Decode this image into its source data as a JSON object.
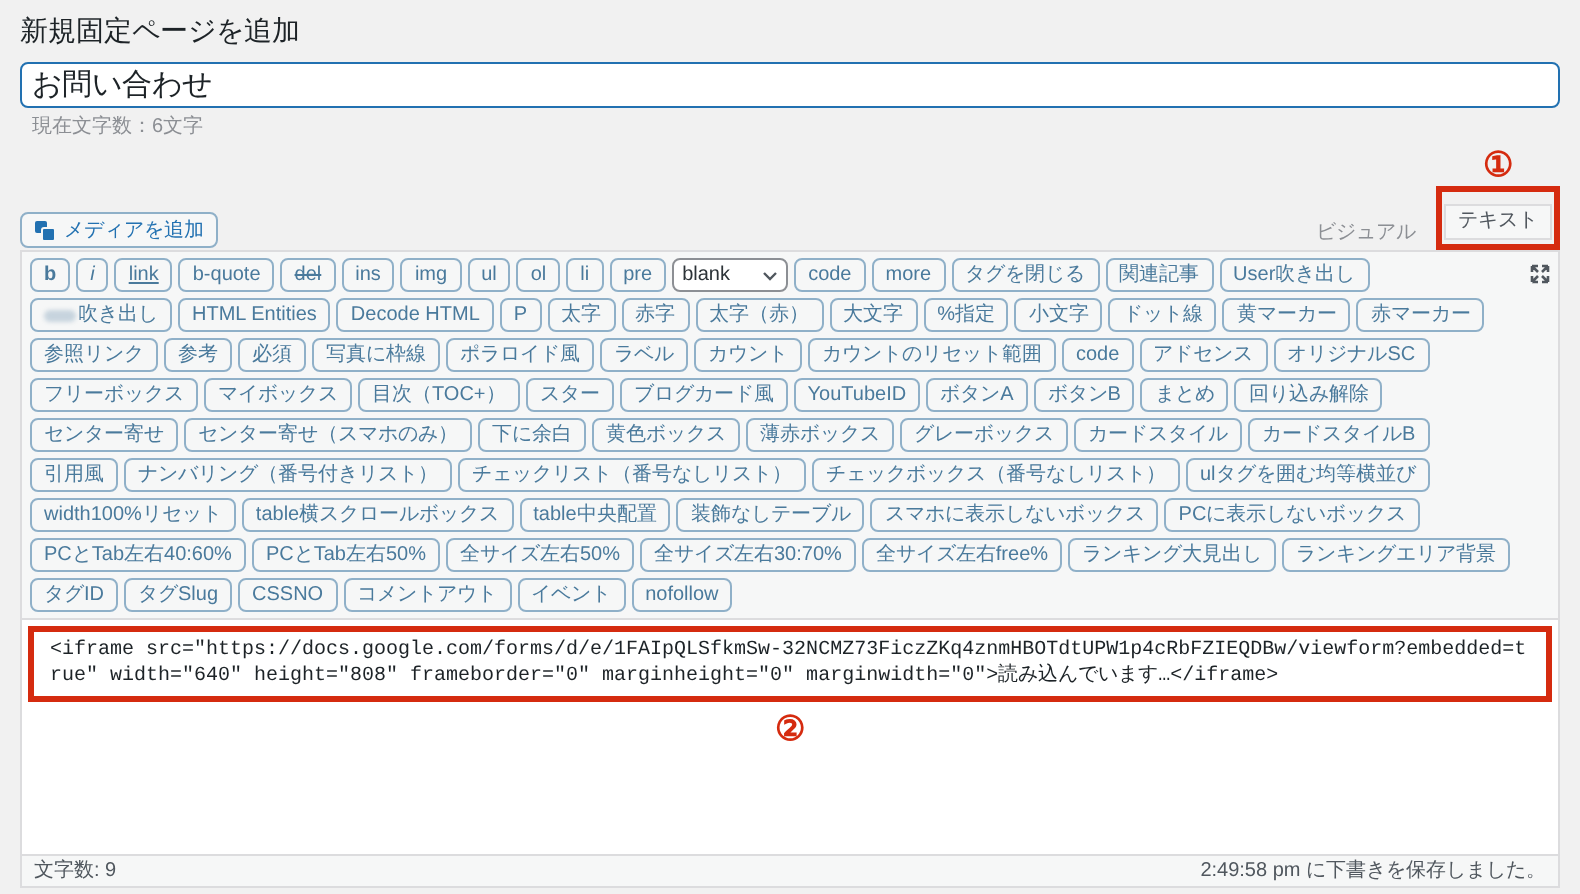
{
  "page_title": "新規固定ページを追加",
  "title_field": {
    "value": "お問い合わせ"
  },
  "char_count": "現在文字数：6文字",
  "media_button": "メディアを追加",
  "annotations": [
    "①",
    "②"
  ],
  "tabs": [
    {
      "label": "ビジュアル",
      "selected": false
    },
    {
      "label": "テキスト",
      "selected": true
    }
  ],
  "toolbar": [
    {
      "label": "b",
      "kind": "bold"
    },
    {
      "label": "i",
      "kind": "italic"
    },
    {
      "label": "link",
      "kind": "underline"
    },
    {
      "label": "b-quote"
    },
    {
      "label": "del",
      "kind": "strike"
    },
    {
      "label": "ins"
    },
    {
      "label": "img"
    },
    {
      "label": "ul"
    },
    {
      "label": "ol"
    },
    {
      "label": "li"
    },
    {
      "label": "pre"
    },
    {
      "label": "blank",
      "kind": "select"
    },
    {
      "label": "code"
    },
    {
      "label": "more"
    },
    {
      "label": "タグを閉じる"
    },
    {
      "label": "関連記事"
    },
    {
      "label": "User吹き出し"
    },
    {
      "label": "吹き出し",
      "kind": "blurred"
    },
    {
      "label": "HTML Entities"
    },
    {
      "label": "Decode HTML"
    },
    {
      "label": "P"
    },
    {
      "label": "太字"
    },
    {
      "label": "赤字"
    },
    {
      "label": "太字（赤）"
    },
    {
      "label": "大文字"
    },
    {
      "label": "%指定"
    },
    {
      "label": "小文字"
    },
    {
      "label": "ドット線"
    },
    {
      "label": "黄マーカー"
    },
    {
      "label": "赤マーカー"
    },
    {
      "label": "参照リンク"
    },
    {
      "label": "参考"
    },
    {
      "label": "必須"
    },
    {
      "label": "写真に枠線"
    },
    {
      "label": "ポラロイド風"
    },
    {
      "label": "ラベル"
    },
    {
      "label": "カウント"
    },
    {
      "label": "カウントのリセット範囲"
    },
    {
      "label": "code"
    },
    {
      "label": "アドセンス"
    },
    {
      "label": "オリジナルSC"
    },
    {
      "label": "フリーボックス"
    },
    {
      "label": "マイボックス"
    },
    {
      "label": "目次（TOC+）"
    },
    {
      "label": "スター"
    },
    {
      "label": "ブログカード風"
    },
    {
      "label": "YouTubeID"
    },
    {
      "label": "ボタンA"
    },
    {
      "label": "ボタンB"
    },
    {
      "label": "まとめ"
    },
    {
      "label": "回り込み解除"
    },
    {
      "label": "センター寄せ"
    },
    {
      "label": "センター寄せ（スマホのみ）"
    },
    {
      "label": "下に余白"
    },
    {
      "label": "黄色ボックス"
    },
    {
      "label": "薄赤ボックス"
    },
    {
      "label": "グレーボックス"
    },
    {
      "label": "カードスタイル"
    },
    {
      "label": "カードスタイルB"
    },
    {
      "label": "引用風"
    },
    {
      "label": "ナンバリング（番号付きリスト）"
    },
    {
      "label": "チェックリスト（番号なしリスト）"
    },
    {
      "label": "チェックボックス（番号なしリスト）"
    },
    {
      "label": "ulタグを囲む均等横並び"
    },
    {
      "label": "width100%リセット"
    },
    {
      "label": "table横スクロールボックス"
    },
    {
      "label": "table中央配置"
    },
    {
      "label": "装飾なしテーブル"
    },
    {
      "label": "スマホに表示しないボックス"
    },
    {
      "label": "PCに表示しないボックス"
    },
    {
      "label": "PCとTab左右40:60%"
    },
    {
      "label": "PCとTab左右50%"
    },
    {
      "label": "全サイズ左右50%"
    },
    {
      "label": "全サイズ左右30:70%"
    },
    {
      "label": "全サイズ左右free%"
    },
    {
      "label": "ランキング大見出し"
    },
    {
      "label": "ランキングエリア背景"
    },
    {
      "label": "タグID"
    },
    {
      "label": "タグSlug"
    },
    {
      "label": "CSSNO"
    },
    {
      "label": "コメントアウト"
    },
    {
      "label": "イベント"
    },
    {
      "label": "nofollow"
    }
  ],
  "code": "<iframe src=\"https://docs.google.com/forms/d/e/1FAIpQLSfkmSw-32NCMZ73FiczZKq4znmHBOTdtUPW1p4cRbFZIEQDBw/viewform?embedded=true\" width=\"640\" height=\"808\" frameborder=\"0\" marginheight=\"0\" marginwidth=\"0\">読み込んでいます…</iframe>",
  "footer": {
    "word_count": "文字数: 9",
    "saved": "2:49:58 pm に下書きを保存しました。"
  }
}
